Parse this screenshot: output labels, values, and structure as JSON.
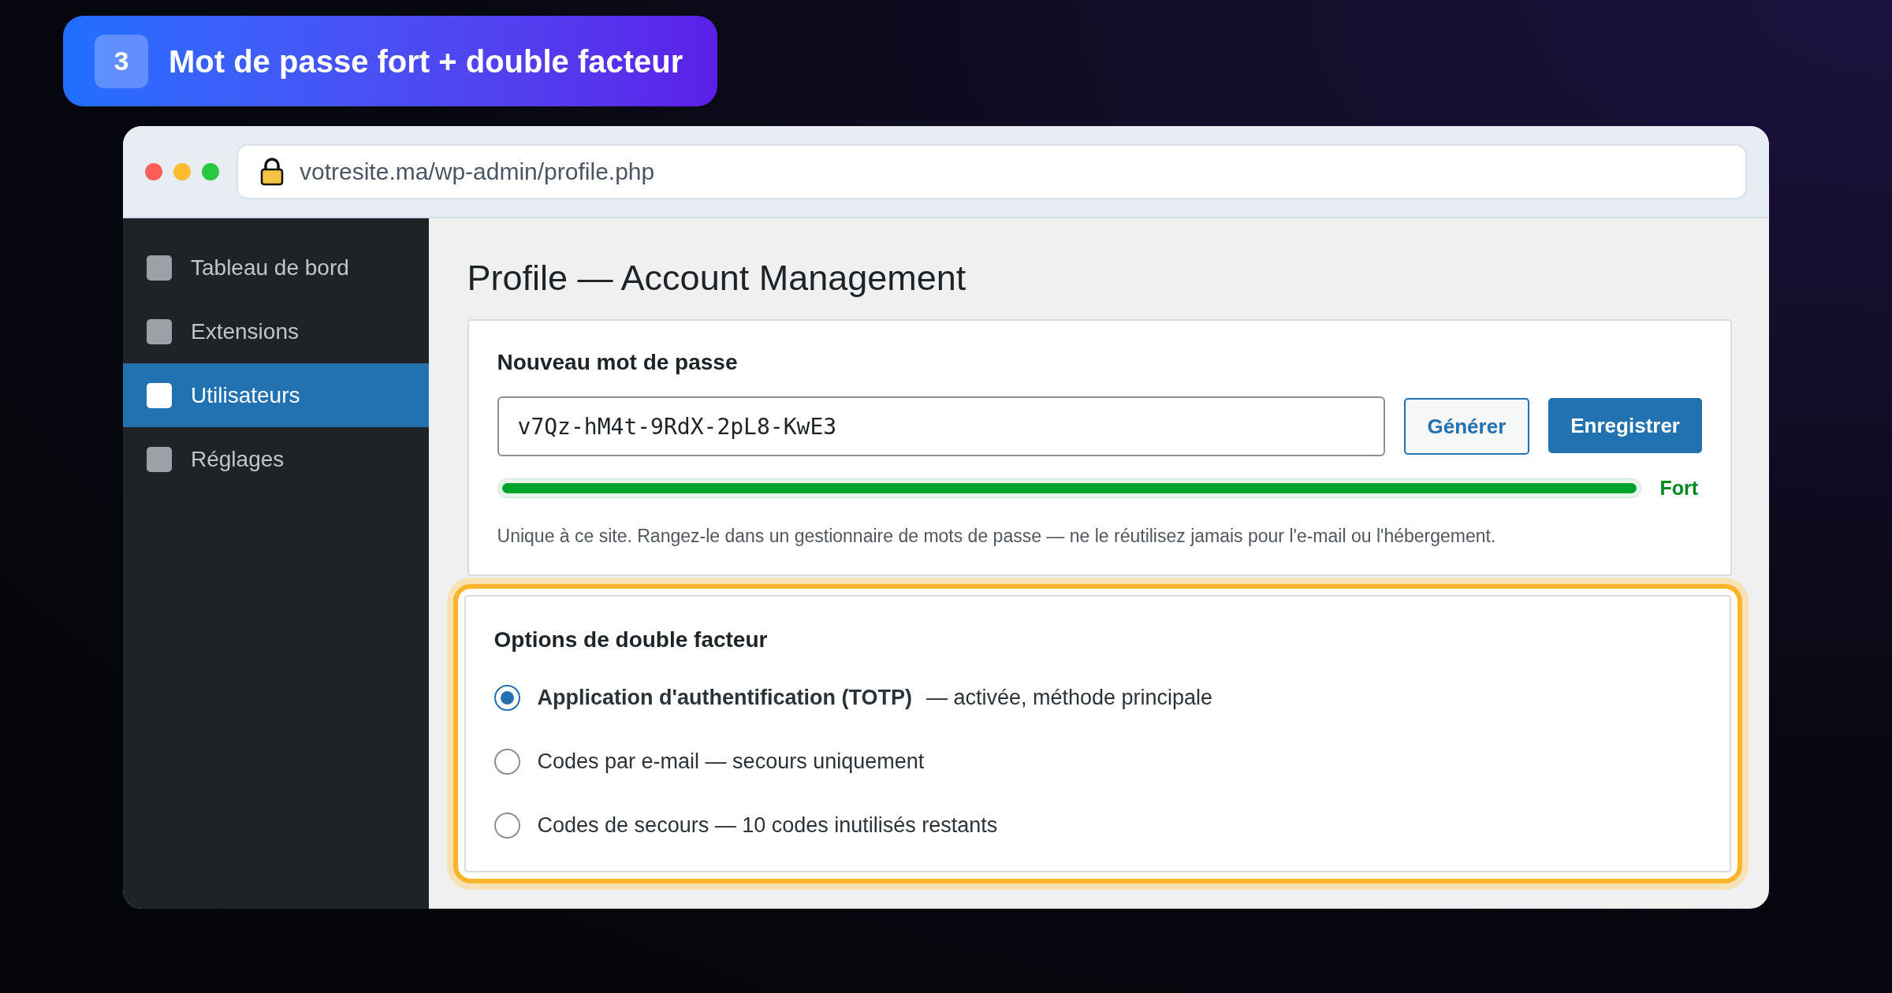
{
  "step_badge": {
    "number": "3",
    "title": "Mot de passe fort + double facteur"
  },
  "browser": {
    "url": "votresite.ma/wp-admin/profile.php"
  },
  "sidebar": {
    "items": [
      {
        "label": "Tableau de bord",
        "selected": false
      },
      {
        "label": "Extensions",
        "selected": false
      },
      {
        "label": "Utilisateurs",
        "selected": true
      },
      {
        "label": "Réglages",
        "selected": false
      }
    ]
  },
  "page_title": "Profile — Account Management",
  "password_card": {
    "heading": "Nouveau mot de passe",
    "value": "v7Qz-hM4t-9RdX-2pL8-KwE3",
    "buttons": [
      {
        "label": "Générer",
        "kind": "secondary"
      },
      {
        "label": "Enregistrer",
        "kind": "primary"
      }
    ],
    "strength": {
      "level": 1,
      "label": "Fort"
    },
    "hint": "Unique à ce site. Rangez-le dans un gestionnaire de mots de passe — ne le réutilisez jamais pour l'e-mail ou l'hébergement."
  },
  "twofa_card": {
    "heading": "Options de double facteur",
    "options": [
      {
        "label": "Application d'authentification (TOTP)",
        "note": "— activée, méthode principale",
        "selected": true
      },
      {
        "label": "Codes par e-mail — secours uniquement",
        "selected": false
      },
      {
        "label": "Codes de secours — 10 codes inutilisés restants",
        "selected": false
      }
    ]
  }
}
